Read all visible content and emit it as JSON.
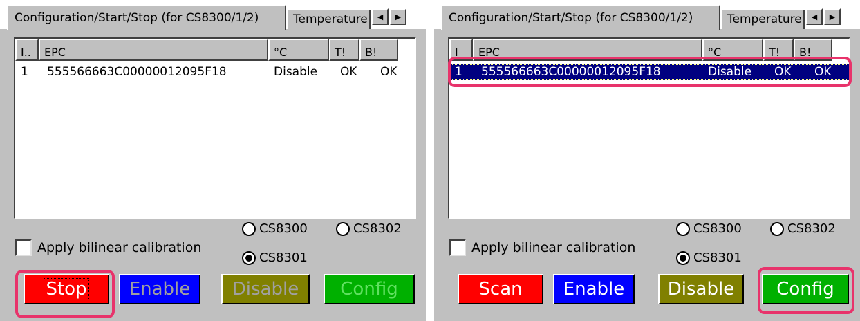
{
  "colors": {
    "scan_red": "#ff0000",
    "enable_blue": "#0000ff",
    "disable_olive": "#808000",
    "config_green": "#00b000",
    "highlight": "#e8336b",
    "selection": "#000080"
  },
  "left": {
    "tab_active": "Configuration/Start/Stop (for CS8300/1/2)",
    "tab_inactive": "Temperature",
    "arrow_left": "◀",
    "arrow_right": "▶",
    "columns": [
      "I..",
      "EPC",
      "°C",
      "T!",
      "B!"
    ],
    "row": {
      "index": "1",
      "epc": "555566663C00000012095F18",
      "temp": "Disable",
      "t": "OK",
      "b": "OK"
    },
    "radio_cs8300": "CS8300",
    "radio_cs8302": "CS8302",
    "radio_cs8301": "CS8301",
    "checkbox_label": "Apply bilinear calibration",
    "buttons": {
      "main": "Stop",
      "enable": "Enable",
      "disable": "Disable",
      "config": "Config"
    }
  },
  "right": {
    "tab_active": "Configuration/Start/Stop (for CS8300/1/2)",
    "tab_inactive": "Temperature",
    "arrow_left": "◀",
    "arrow_right": "▶",
    "columns": [
      "I",
      "EPC",
      "°C",
      "T!",
      "B!"
    ],
    "row": {
      "index": "1",
      "epc": "555566663C00000012095F18",
      "temp": "Disable",
      "t": "OK",
      "b": "OK"
    },
    "radio_cs8300": "CS8300",
    "radio_cs8302": "CS8302",
    "radio_cs8301": "CS8301",
    "checkbox_label": "Apply bilinear calibration",
    "buttons": {
      "main": "Scan",
      "enable": "Enable",
      "disable": "Disable",
      "config": "Config"
    }
  }
}
